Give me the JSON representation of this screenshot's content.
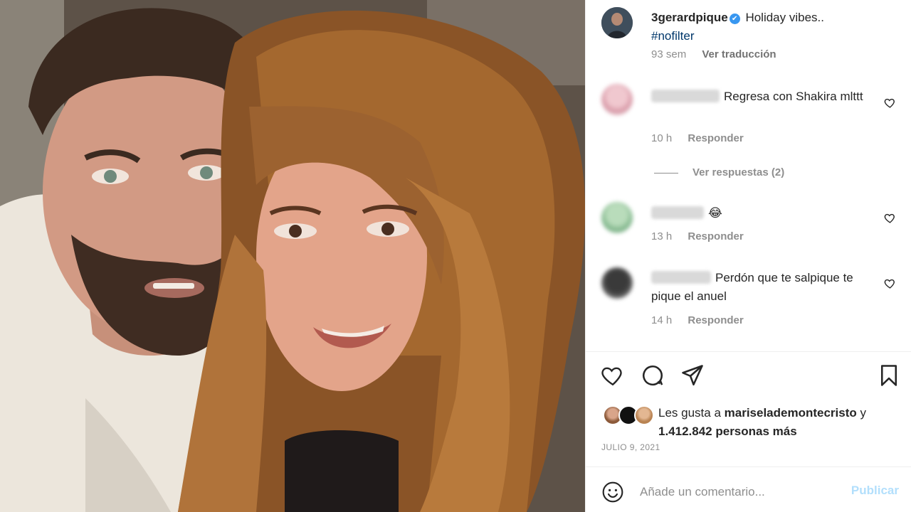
{
  "post": {
    "username": "3gerardpique",
    "verified_glyph": "✔",
    "caption": "Holiday vibes..",
    "hashtag": "#nofilter",
    "age": "93 sem",
    "translate_label": "Ver traducción"
  },
  "comments": [
    {
      "text": "Regresa con Shakira mlttt",
      "time": "10 h",
      "reply_label": "Responder",
      "avatar_color": "#e7b6c1"
    },
    {
      "text": "😂",
      "time": "13 h",
      "reply_label": "Responder",
      "avatar_color": "#9bc79f"
    },
    {
      "text": "Perdón que te salpique te pique el anuel",
      "time": "14 h",
      "reply_label": "Responder",
      "avatar_color": "#4a4a4a"
    }
  ],
  "view_replies": "Ver respuestas (2)",
  "likes": {
    "prefix": "Les gusta a",
    "user": "mariselademontecristo",
    "connector": "y",
    "count": "1.412.842 personas más"
  },
  "date": "JULIO 9, 2021",
  "comment_box": {
    "placeholder": "Añade un comentario...",
    "publish_label": "Publicar"
  },
  "icons": {
    "like": "heart-icon",
    "comment": "comment-icon",
    "share": "send-icon",
    "save": "bookmark-icon",
    "emoji": "emoji-icon",
    "comment_like": "heart-outline-icon"
  },
  "colors": {
    "link": "#00376b",
    "verified": "#3897f0",
    "publish_disabled": "#b2dffc",
    "muted": "#8e8e8e"
  }
}
